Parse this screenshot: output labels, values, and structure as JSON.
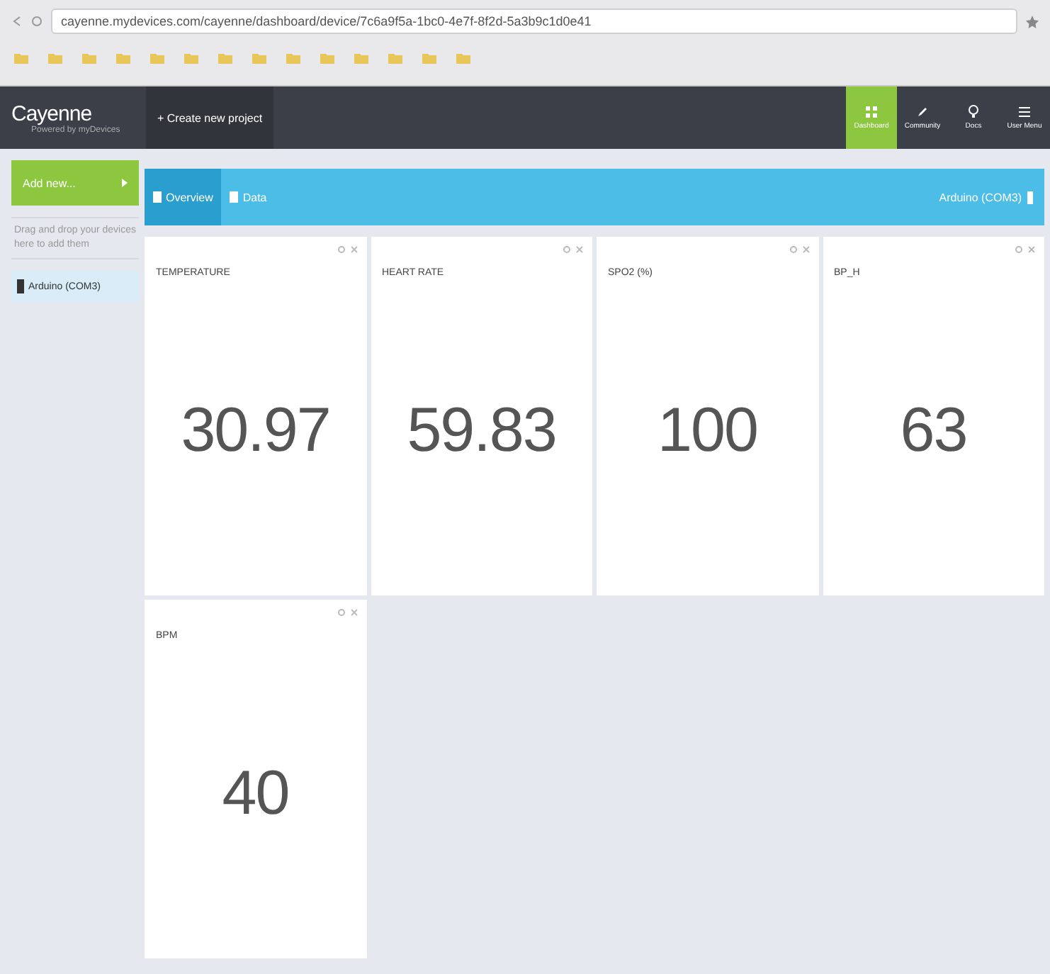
{
  "browser": {
    "url": "cayenne.mydevices.com/cayenne/dashboard/device/7c6a9f5a-1bc0-4e7f-8f2d-5a3b9c1d0e41"
  },
  "app": {
    "logo": "Cayenne",
    "tagline": "Powered by myDevices",
    "new_project": "+ Create new project",
    "nav": [
      {
        "label": "Dashboard",
        "selected": true,
        "kind": "grid"
      },
      {
        "label": "Community",
        "selected": false,
        "kind": "pen"
      },
      {
        "label": "Docs",
        "selected": false,
        "kind": "bulb"
      },
      {
        "label": "User Menu",
        "selected": false,
        "kind": "menu"
      }
    ]
  },
  "sidebar": {
    "add_button": "Add new...",
    "hint": "Drag and drop your devices here to add them",
    "devices": [
      {
        "label": "Arduino (COM3)",
        "selected": true
      }
    ]
  },
  "header": {
    "tabs": [
      {
        "label": "Overview",
        "selected": true
      },
      {
        "label": "Data",
        "selected": false
      }
    ],
    "device": "Arduino (COM3)"
  },
  "widgets": [
    {
      "title": "TEMPERATURE",
      "value": "30.97"
    },
    {
      "title": "HEART RATE",
      "value": "59.83"
    },
    {
      "title": "SPO2 (%)",
      "value": "100"
    },
    {
      "title": "BP_H",
      "value": "63"
    },
    {
      "title": "BPM",
      "value": "40"
    }
  ]
}
